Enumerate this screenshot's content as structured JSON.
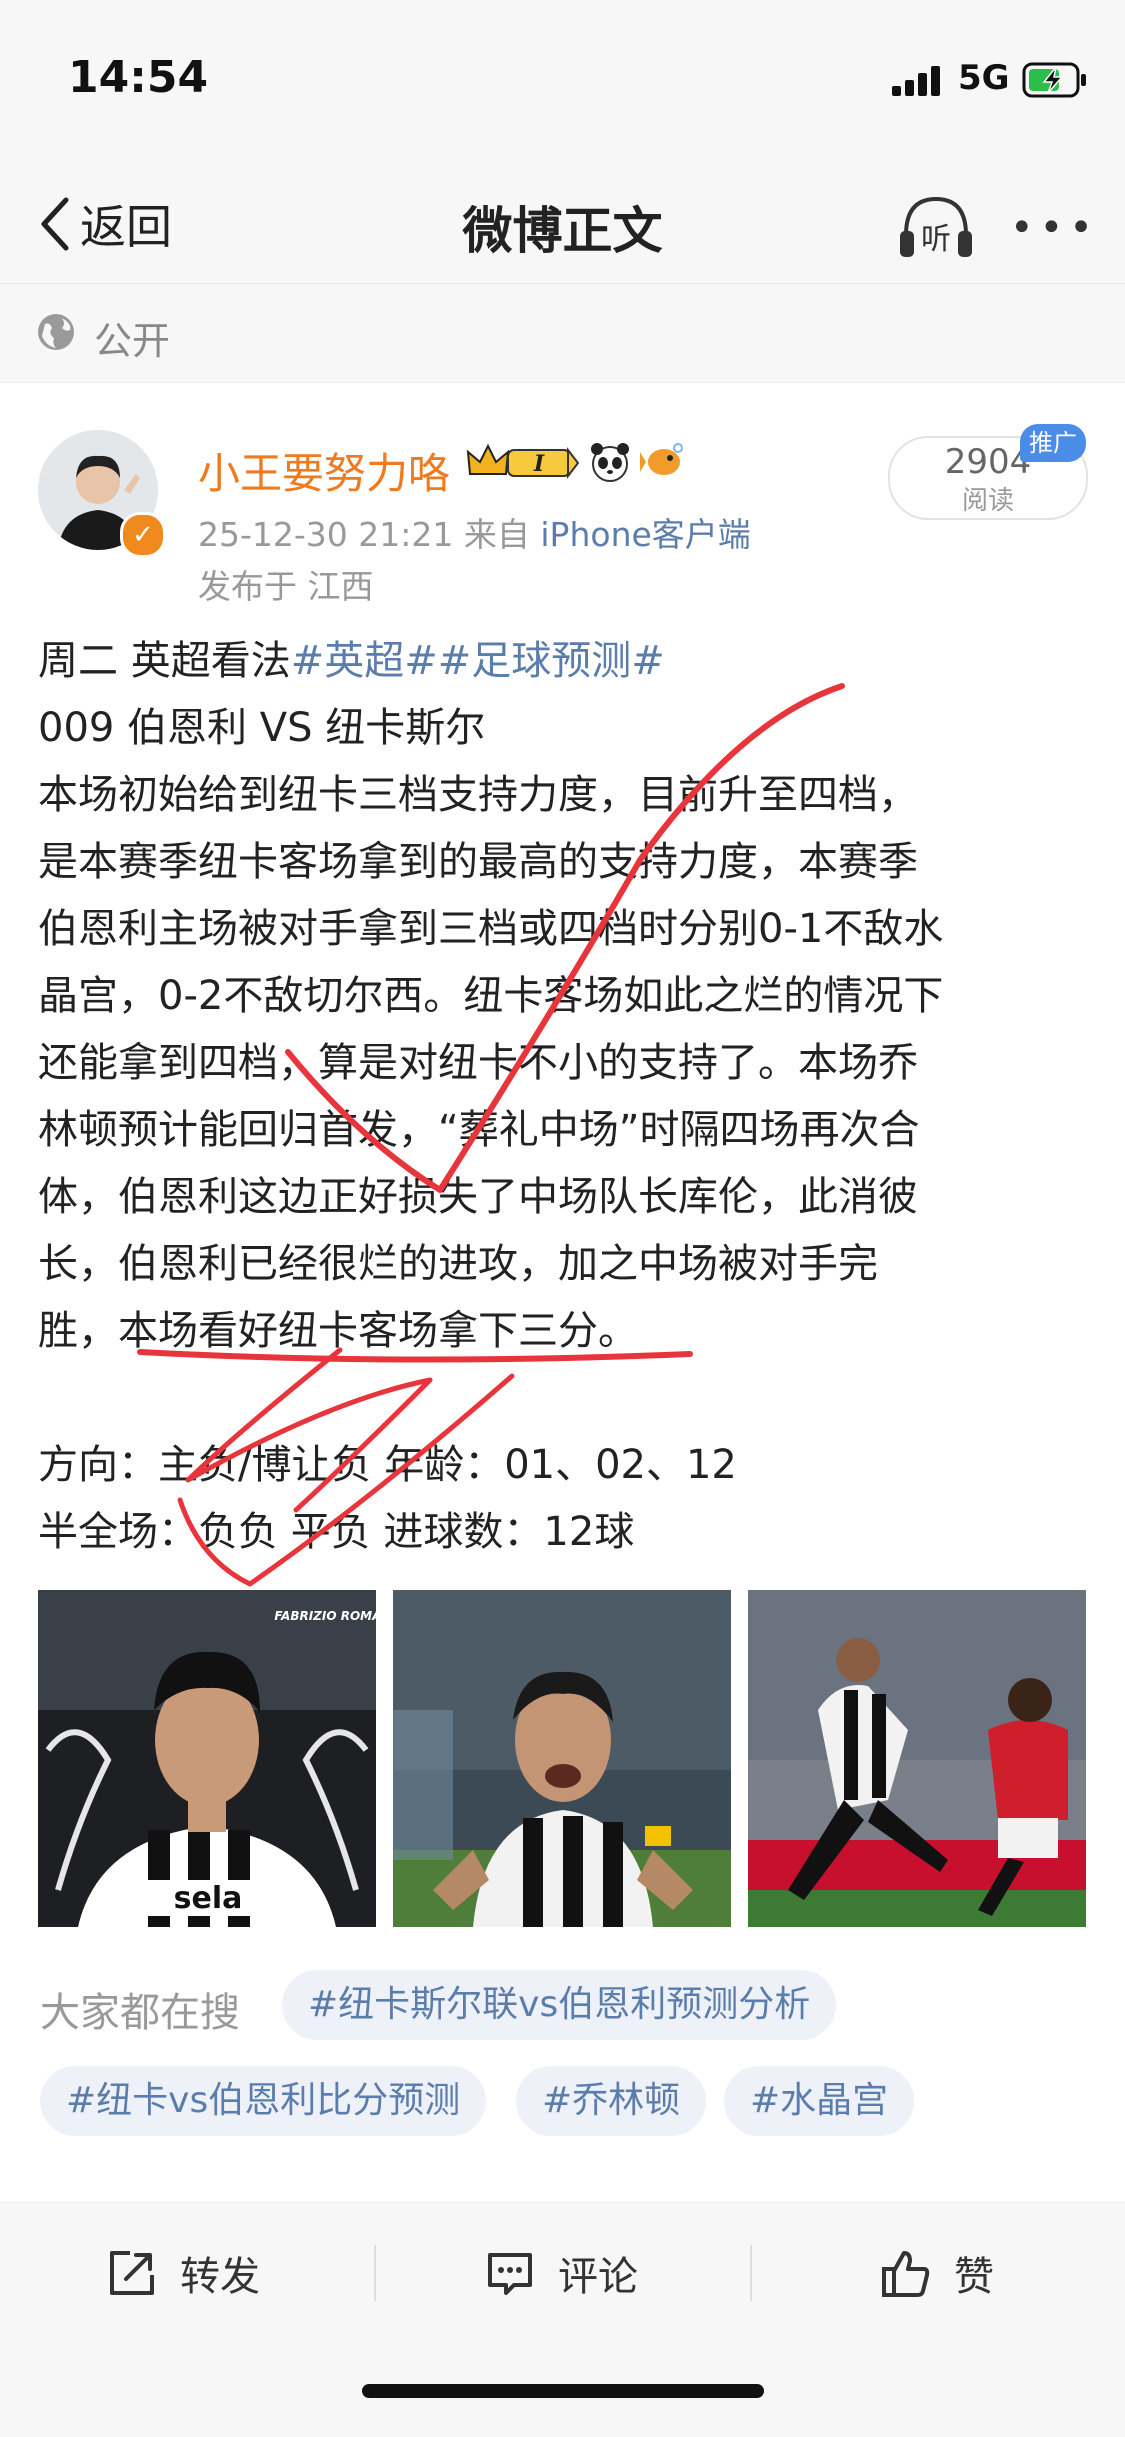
{
  "status_bar": {
    "time": "14:54",
    "network": "5G"
  },
  "nav": {
    "back_label": "返回",
    "title": "微博正文",
    "listen_label": "听"
  },
  "visibility": {
    "label": "公开"
  },
  "author": {
    "name": "小王要努力咯",
    "badge_level": "I",
    "posted_at": "25-12-30 21:21",
    "source_prefix": "来自",
    "source": "iPhone客户端",
    "location": "发布于 江西",
    "reads_count": "2904",
    "reads_label": "阅读",
    "promo_label": "推广"
  },
  "post": {
    "line1_text": "周二  英超看法",
    "line1_tags": "#英超##足球预测#",
    "line2": "009  伯恩利 VS 纽卡斯尔",
    "line3": "本场初始给到纽卡三档支持力度，目前升至四档，",
    "line4": "是本赛季纽卡客场拿到的最高的支持力度，本赛季",
    "line5": "伯恩利主场被对手拿到三档或四档时分别0-1不敌水",
    "line6": "晶宫，0-2不敌切尔西。纽卡客场如此之烂的情况下",
    "line7": "还能拿到四档，算是对纽卡不小的支持了。本场乔",
    "line8": "林顿预计能回归首发，“葬礼中场”时隔四场再次合",
    "line9": "体，伯恩利这边正好损失了中场队长库伦，此消彼",
    "line10": "长，伯恩利已经很烂的进攻，加之中场被对手完",
    "line11": "胜，本场看好纽卡客场拿下三分。",
    "line12": "方向：主负/博让负     年龄：01、02、12",
    "line13": "半全场：负负 平负     进球数：12球"
  },
  "photos": {
    "photo1_caption": "FABRIZIO ROMANO",
    "sponsor_text": "sela"
  },
  "trending": {
    "label": "大家都在搜",
    "chips": [
      "#纽卡斯尔联vs伯恩利预测分析",
      "#纽卡vs伯恩利比分预测",
      "#乔林顿",
      "#水晶宫"
    ]
  },
  "actions": {
    "repost": "转发",
    "comment": "评论",
    "like": "赞"
  },
  "colors": {
    "accent_orange": "#f07a1e",
    "link_blue": "#5b7dab",
    "annotation_red": "#e8353b"
  }
}
